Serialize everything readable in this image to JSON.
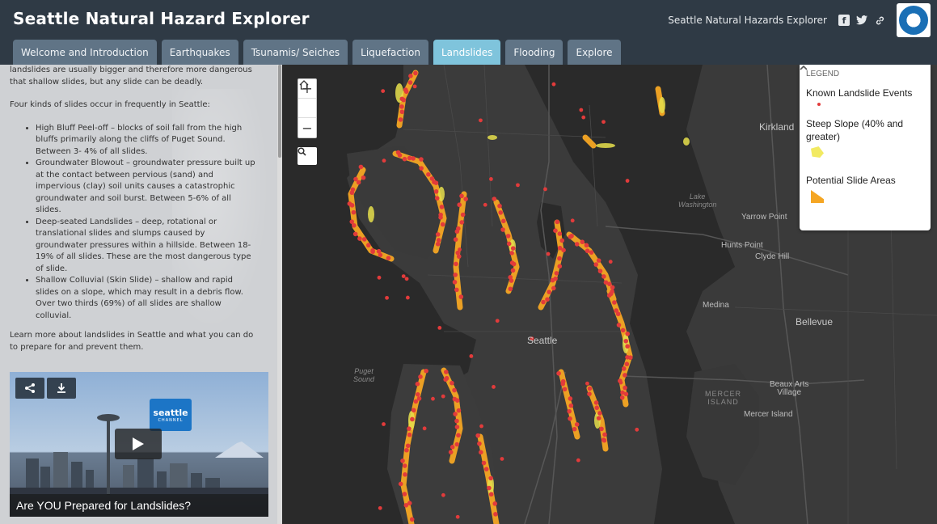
{
  "header": {
    "title": "Seattle Natural Hazard Explorer",
    "site_link": "Seattle Natural Hazards Explorer",
    "social": [
      "f",
      "t",
      "link"
    ]
  },
  "tabs": [
    {
      "label": "Welcome and Introduction",
      "active": false
    },
    {
      "label": "Earthquakes",
      "active": false
    },
    {
      "label": "Tsunamis/ Seiches",
      "active": false
    },
    {
      "label": "Liquefaction",
      "active": false
    },
    {
      "label": "Landslides",
      "active": true
    },
    {
      "label": "Flooding",
      "active": false
    },
    {
      "label": "Explore",
      "active": false
    }
  ],
  "side": {
    "intro": "landslides are usually bigger and therefore more dangerous that shallow slides, but any slide can be deadly.",
    "kinds_heading": "Four kinds of slides occur in frequently in Seattle:",
    "kinds": [
      "High Bluff Peel-off – blocks of soil fall from the high bluffs primarily along the cliffs of Puget Sound. Between 3- 4% of all slides.",
      "Groundwater Blowout – groundwater pressure built up at the contact between pervious (sand) and impervious (clay) soil units causes a catastrophic groundwater and soil burst. Between 5-6% of all slides.",
      "Deep-seated Landslides – deep, rotational or translational slides and slumps caused by groundwater pressures within a hillside. Between 18-19% of all slides. These are the most dangerous type of slide.",
      "Shallow Colluvial (Skin Slide) – shallow and rapid slides on a slope, which may result in a debris flow. Over two thirds (69%) of all slides are shallow colluvial."
    ],
    "learn_more": "Learn more about landslides in Seattle and what you can do to prepare for and prevent them.",
    "video": {
      "caption": "Are YOU Prepared for Landslides?",
      "logo_text": "seattle",
      "logo_sub": "CHANNEL",
      "share_icon": "share-icon",
      "download_icon": "download-icon",
      "play_icon": "play-icon"
    }
  },
  "map": {
    "zoom_in": "+",
    "zoom_out": "−",
    "home": "⌂",
    "search": "⚲",
    "labels": {
      "kirkland": "Kirkland",
      "lake_washington": "Lake\nWashington",
      "yarrow_point": "Yarrow Point",
      "hunts_point": "Hunts Point",
      "clyde_hill": "Clyde Hill",
      "medina": "Medina",
      "bellevue": "Bellevue",
      "seattle": "Seattle",
      "puget_sound": "Puget\nSound",
      "mercer_island_water": "MERCER\nISLAND",
      "beaux_arts": "Beaux Arts\nVillage",
      "mercer_island": "Mercer Island"
    }
  },
  "legend": {
    "heading": "LEGEND",
    "items": [
      {
        "label": "Known Landslide Events",
        "color": "#e23b3b"
      },
      {
        "label": "Steep Slope (40% and greater)",
        "color": "#f2ea62"
      },
      {
        "label": "Potential Slide Areas",
        "color": "#f5a623"
      }
    ]
  },
  "colors": {
    "header_bg": "#2f3a45",
    "tab_bg": "#607486",
    "tab_active": "#7fc4dc",
    "map_land": "#3a3a3a",
    "map_water": "#2a2a2a",
    "slide_orange": "#f5a623",
    "steep_yellow": "#f2ea62",
    "event_red": "#e23b3b"
  }
}
